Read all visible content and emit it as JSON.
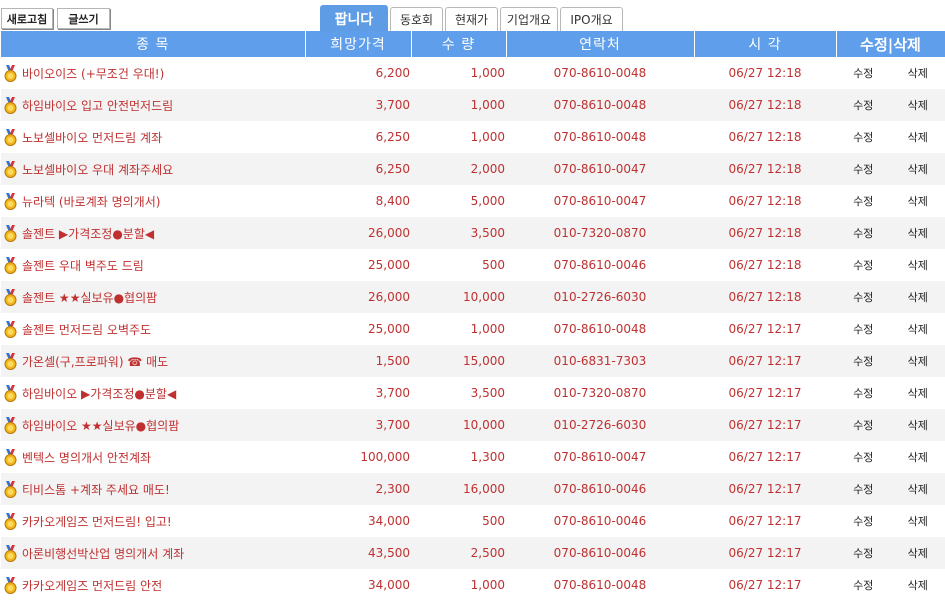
{
  "toolbar": {
    "refresh_label": "새로고침",
    "write_label": "글쓰기"
  },
  "tabs": [
    "팝니다",
    "동호회",
    "현재가",
    "기업개요",
    "IPO개요"
  ],
  "active_tab": 0,
  "columns": {
    "name": "종 목",
    "price": "희망가격",
    "qty": "수 량",
    "phone": "연락처",
    "time": "시 각",
    "actions": "수정|삭제"
  },
  "row_actions": {
    "edit": "수정",
    "delete": "삭제"
  },
  "rows": [
    {
      "name": "바이오이즈 (+무조건 우대!)",
      "price": "6,200",
      "qty": "1,000",
      "phone": "070-8610-0048",
      "time": "06/27 12:18"
    },
    {
      "name": "하임바이오 입고 안전먼저드림",
      "price": "3,700",
      "qty": "1,000",
      "phone": "070-8610-0048",
      "time": "06/27 12:18"
    },
    {
      "name": "노보셀바이오 먼저드림 계좌",
      "price": "6,250",
      "qty": "1,000",
      "phone": "070-8610-0048",
      "time": "06/27 12:18"
    },
    {
      "name": "노보셀바이오 우대 계좌주세요",
      "price": "6,250",
      "qty": "2,000",
      "phone": "070-8610-0047",
      "time": "06/27 12:18"
    },
    {
      "name": "뉴라텍 (바로계좌 명의개서)",
      "price": "8,400",
      "qty": "5,000",
      "phone": "070-8610-0047",
      "time": "06/27 12:18"
    },
    {
      "name": "솔젠트 ▶가격조정●분할◀",
      "price": "26,000",
      "qty": "3,500",
      "phone": "010-7320-0870",
      "time": "06/27 12:18"
    },
    {
      "name": "솔젠트 우대 벽주도 드림",
      "price": "25,000",
      "qty": "500",
      "phone": "070-8610-0046",
      "time": "06/27 12:18"
    },
    {
      "name": "솔젠트 ★★실보유●협의팜",
      "price": "26,000",
      "qty": "10,000",
      "phone": "010-2726-6030",
      "time": "06/27 12:18"
    },
    {
      "name": "솔젠트 먼저드림 오벽주도",
      "price": "25,000",
      "qty": "1,000",
      "phone": "070-8610-0048",
      "time": "06/27 12:17"
    },
    {
      "name": "가온셀(구,프로파워) ☎ 매도",
      "price": "1,500",
      "qty": "15,000",
      "phone": "010-6831-7303",
      "time": "06/27 12:17"
    },
    {
      "name": "하임바이오 ▶가격조정●분할◀",
      "price": "3,700",
      "qty": "3,500",
      "phone": "010-7320-0870",
      "time": "06/27 12:17"
    },
    {
      "name": "하임바이오 ★★실보유●협의팜",
      "price": "3,700",
      "qty": "10,000",
      "phone": "010-2726-6030",
      "time": "06/27 12:17"
    },
    {
      "name": "벤텍스 명의개서 안전계좌",
      "price": "100,000",
      "qty": "1,300",
      "phone": "070-8610-0047",
      "time": "06/27 12:17"
    },
    {
      "name": "티비스톰 +계좌 주세요 매도!",
      "price": "2,300",
      "qty": "16,000",
      "phone": "070-8610-0046",
      "time": "06/27 12:17"
    },
    {
      "name": "카카오게임즈 먼저드림! 입고!",
      "price": "34,000",
      "qty": "500",
      "phone": "070-8610-0046",
      "time": "06/27 12:17"
    },
    {
      "name": "아론비행선박산업 명의개서 계좌",
      "price": "43,500",
      "qty": "2,500",
      "phone": "070-8610-0046",
      "time": "06/27 12:17"
    },
    {
      "name": "카카오게임즈 먼저드림 안전",
      "price": "34,000",
      "qty": "1,000",
      "phone": "070-8610-0048",
      "time": "06/27 12:17"
    }
  ],
  "icons": {
    "row_icon": "gold-medal-icon"
  },
  "colors": {
    "header_bg": "#5f9eea",
    "active_tab_bg": "#5e9ce6",
    "row_text": "#c03030",
    "row_alt_bg": "#f3f3f3"
  }
}
